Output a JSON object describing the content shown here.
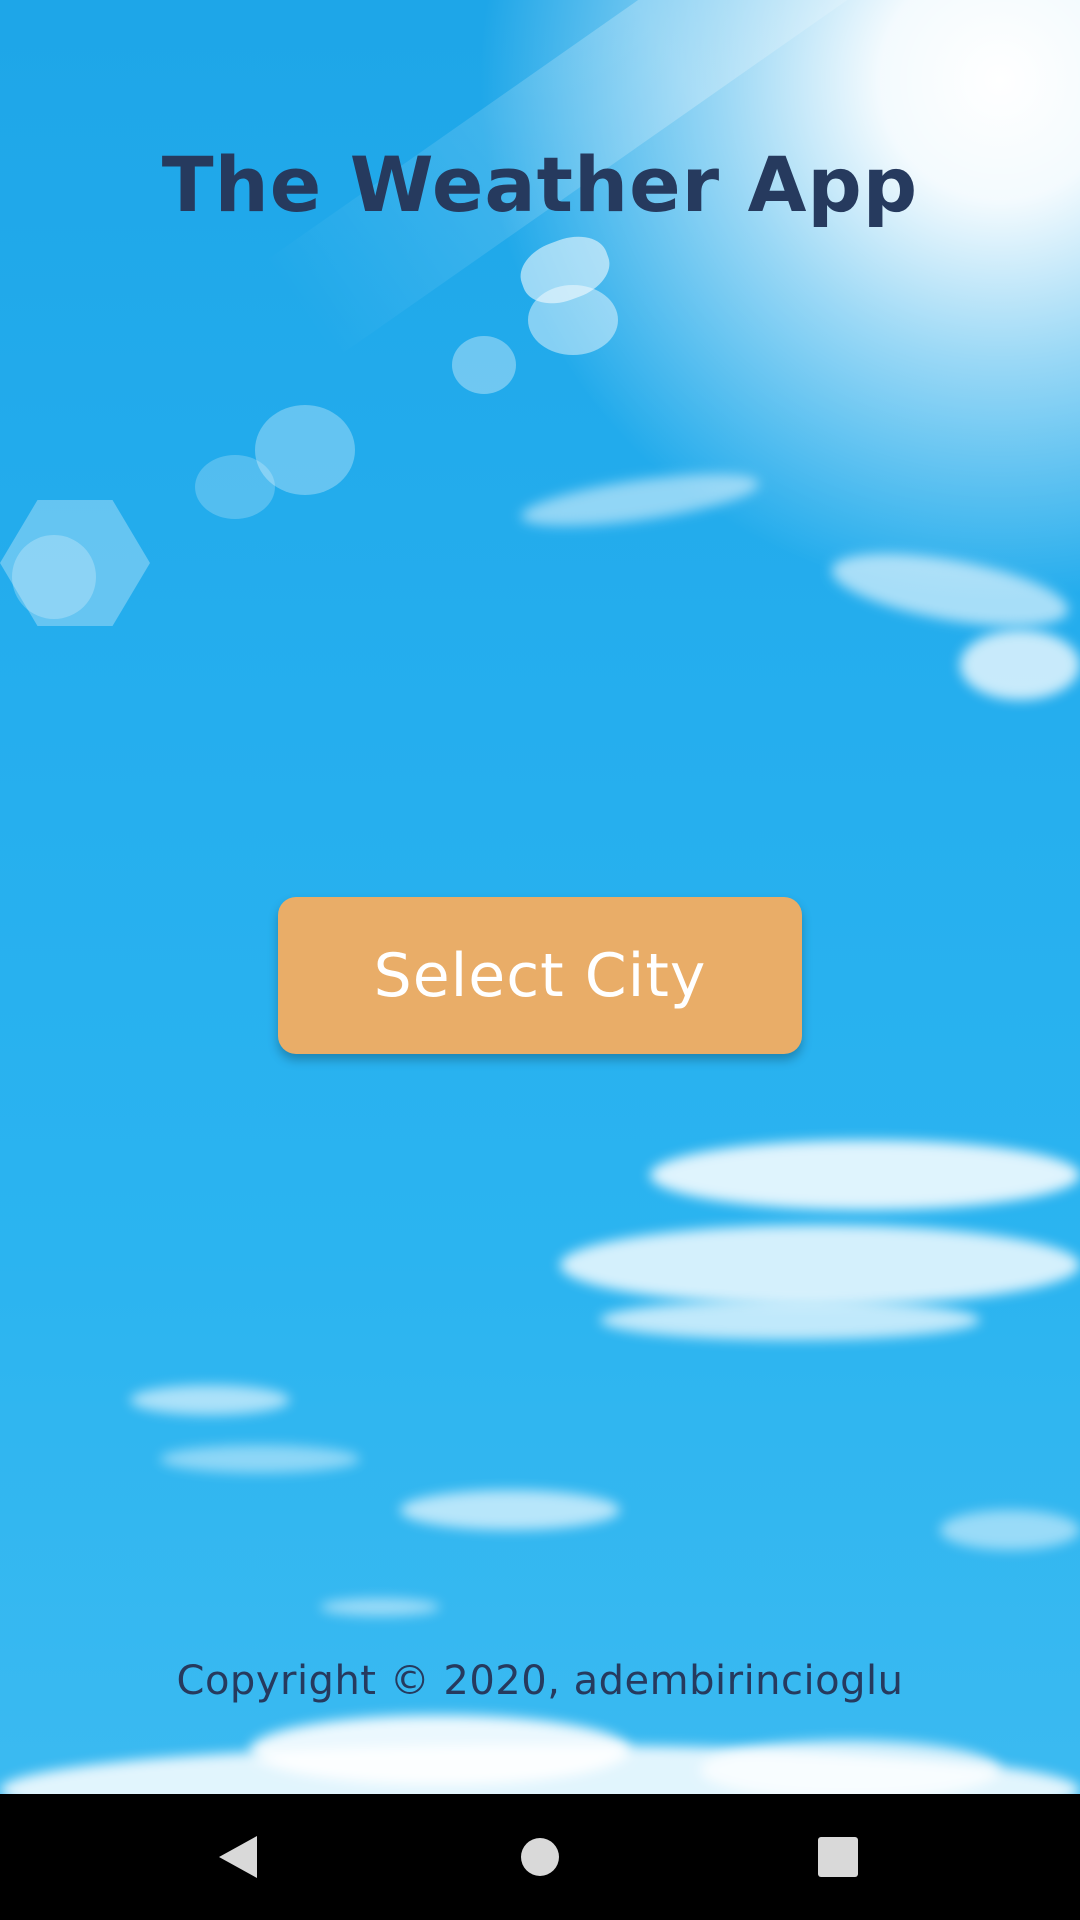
{
  "app": {
    "title": "The Weather App",
    "select_city_label": "Select City",
    "copyright": "Copyright © 2020, adembirincioglu"
  },
  "colors": {
    "title_text": "#263a5e",
    "button_bg": "#e9ad68",
    "button_text": "#ffffff",
    "sky": "#2bb4f0",
    "nav_bar": "#000000"
  },
  "navbar": {
    "back_icon": "back-triangle-icon",
    "home_icon": "home-circle-icon",
    "recents_icon": "recents-square-icon"
  }
}
